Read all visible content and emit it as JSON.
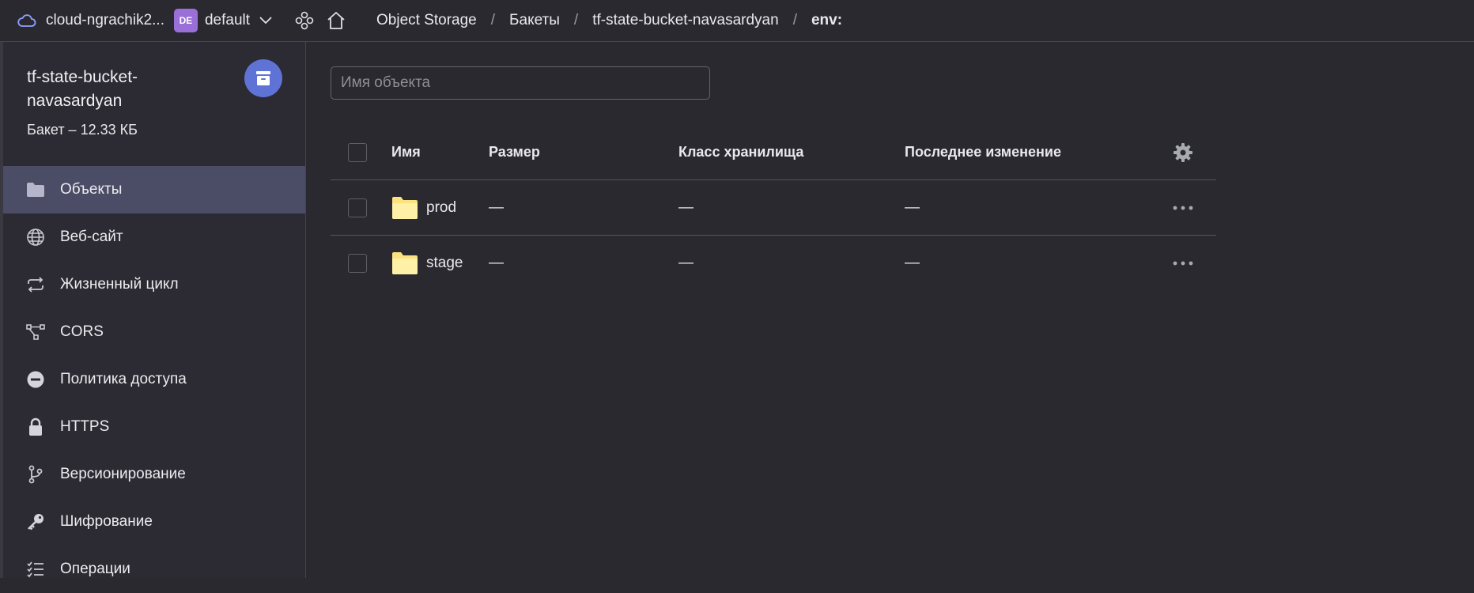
{
  "topbar": {
    "cloud_name": "cloud-ngrachik2...",
    "folder_badge": "DE",
    "folder_name": "default",
    "breadcrumbs": [
      "Object Storage",
      "Бакеты",
      "tf-state-bucket-navasardyan",
      "env:"
    ]
  },
  "sidebar": {
    "bucket_title": "tf-state-bucket-navasardyan",
    "bucket_subtitle": "Бакет – 12.33 КБ",
    "items": [
      {
        "label": "Объекты",
        "icon": "folder-icon",
        "active": true
      },
      {
        "label": "Веб-сайт",
        "icon": "globe-icon"
      },
      {
        "label": "Жизненный цикл",
        "icon": "cycle-icon"
      },
      {
        "label": "CORS",
        "icon": "cors-icon"
      },
      {
        "label": "Политика доступа",
        "icon": "no-entry-icon"
      },
      {
        "label": "HTTPS",
        "icon": "lock-icon"
      },
      {
        "label": "Версионирование",
        "icon": "branch-icon"
      },
      {
        "label": "Шифрование",
        "icon": "key-icon"
      },
      {
        "label": "Операции",
        "icon": "checklist-icon"
      }
    ]
  },
  "search": {
    "placeholder": "Имя объекта"
  },
  "table": {
    "columns": [
      "Имя",
      "Размер",
      "Класс хранилища",
      "Последнее изменение"
    ],
    "rows": [
      {
        "name": "prod",
        "size": "—",
        "class": "—",
        "modified": "—"
      },
      {
        "name": "stage",
        "size": "—",
        "class": "—",
        "modified": "—"
      }
    ]
  },
  "colors": {
    "background": "#2a2930",
    "active_nav": "#4b4c66",
    "avatar": "#5f72d6",
    "folder_badge": "#9a6fd8",
    "folder_icon": "#fbe27f"
  }
}
